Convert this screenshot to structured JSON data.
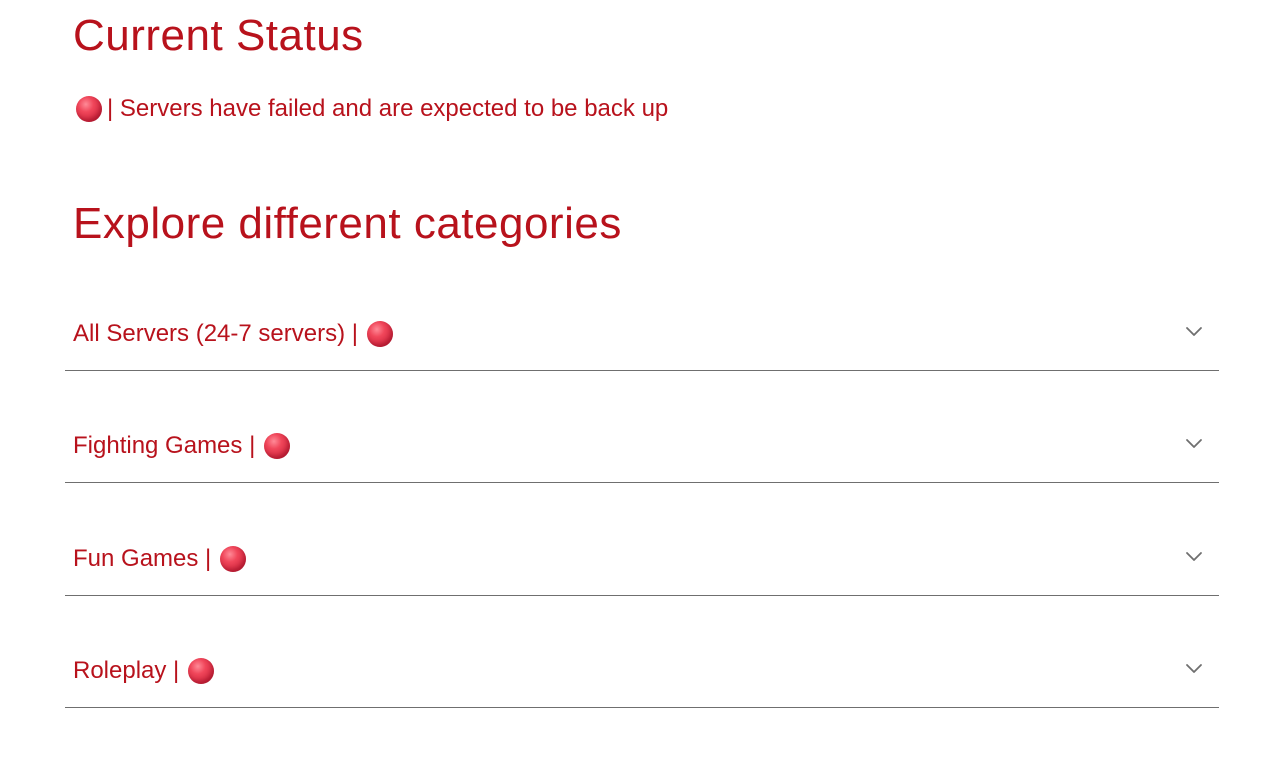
{
  "status": {
    "title": "Current Status",
    "indicator_icon": "red-circle-icon",
    "message": "| Servers have failed and are expected to be back up"
  },
  "explore": {
    "title": "Explore different categories"
  },
  "categories": [
    {
      "label": "All Servers (24-7 servers) |",
      "status_icon": "red-circle-icon",
      "expand_icon": "chevron-down-icon"
    },
    {
      "label": "Fighting Games |",
      "status_icon": "red-circle-icon",
      "expand_icon": "chevron-down-icon"
    },
    {
      "label": "Fun Games |",
      "status_icon": "red-circle-icon",
      "expand_icon": "chevron-down-icon"
    },
    {
      "label": "Roleplay |",
      "status_icon": "red-circle-icon",
      "expand_icon": "chevron-down-icon"
    }
  ],
  "colors": {
    "text_accent": "#b8121c",
    "status_dot": "#e03a52",
    "divider": "#6f6f6f",
    "chevron": "#6f6f6f",
    "background": "#ffffff"
  }
}
